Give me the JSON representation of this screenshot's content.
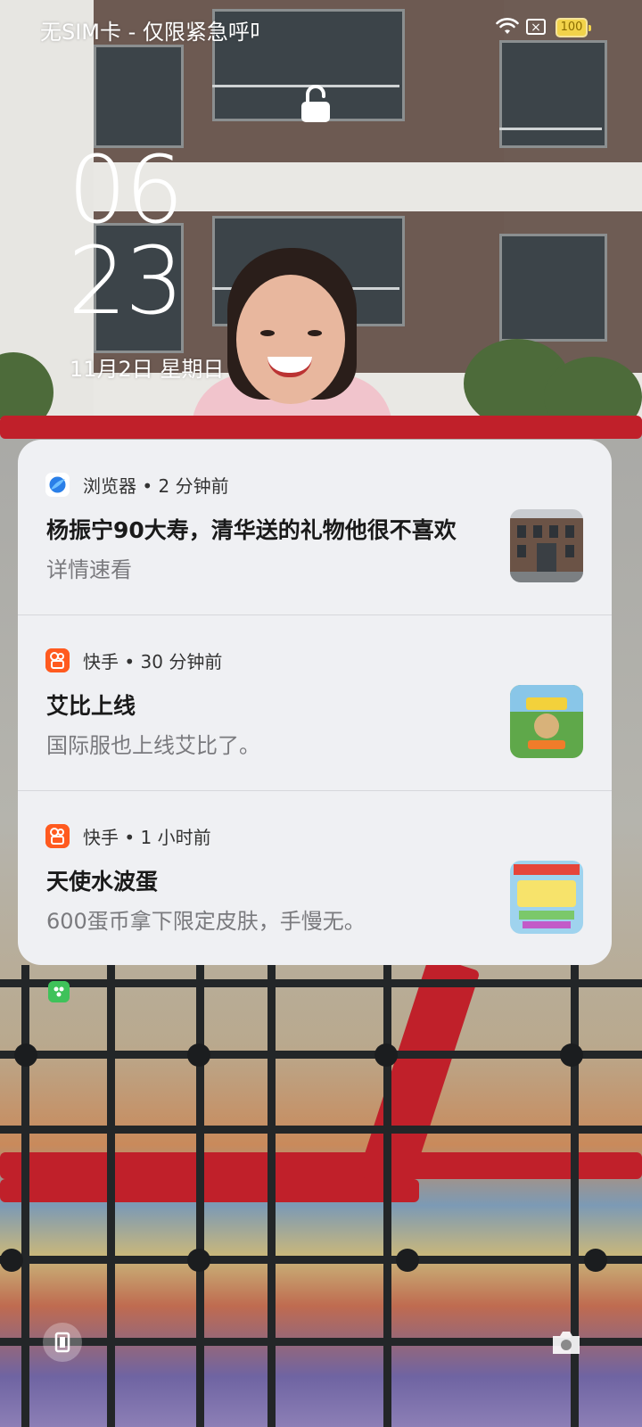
{
  "status_bar": {
    "carrier": "无SIM卡 - 仅限紧急呼叫",
    "battery": "100"
  },
  "clock": {
    "hour": "06",
    "minute": "23",
    "date": "11月2日  星期日"
  },
  "notifications": [
    {
      "app": "浏览器",
      "time": "2 分钟前",
      "meta": "浏览器 • 2 分钟前",
      "title": "杨振宁90大寿，清华送的礼物他很不喜欢",
      "body": "详情速看",
      "icon": "browser-icon"
    },
    {
      "app": "快手",
      "time": "30 分钟前",
      "meta": "快手 • 30 分钟前",
      "title": "艾比上线",
      "body": "国际服也上线艾比了。",
      "icon": "kuaishou-icon"
    },
    {
      "app": "快手",
      "time": "1 小时前",
      "meta": "快手 • 1 小时前",
      "title": "天使水波蛋",
      "body": "600蛋币拿下限定皮肤，手慢无。",
      "icon": "kuaishou-icon"
    }
  ],
  "colors": {
    "kuaishou": "#ff5a1f",
    "battery": "#f2d34a",
    "panel": "#eff0f3"
  }
}
